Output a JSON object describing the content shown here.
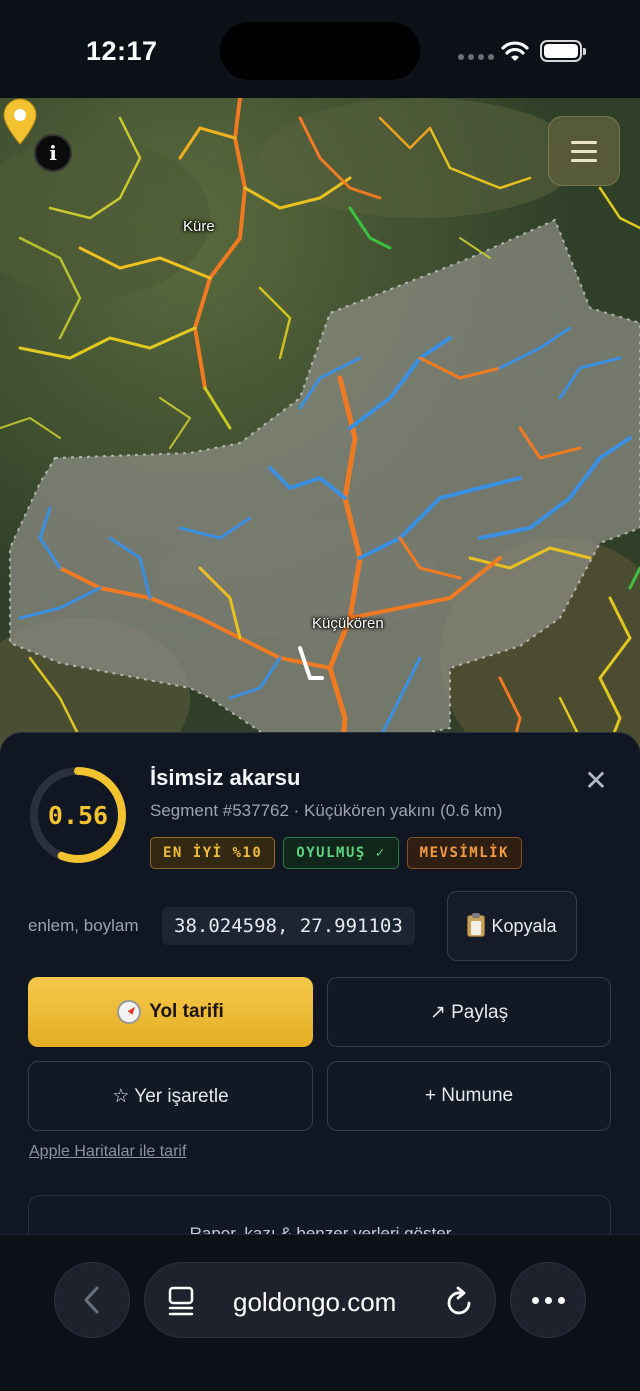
{
  "status_bar": {
    "time": "12:17"
  },
  "map": {
    "places": [
      {
        "name": "Küre"
      },
      {
        "name": "Küçükören"
      }
    ],
    "info_icon": "info-icon",
    "menu_icon": "hamburger-menu-icon",
    "pin_color": "#f2c230"
  },
  "detail": {
    "score": "0.56",
    "score_fraction": 0.56,
    "title": "İsimsiz akarsu",
    "subtitle": "Segment #537762 · Küçükören yakını (0.6 km)",
    "badges": [
      {
        "label": "EN İYİ %10",
        "tone": "gold"
      },
      {
        "label": "OYULMUŞ ✓",
        "tone": "green"
      },
      {
        "label": "MEVSİMLİK",
        "tone": "orange"
      }
    ],
    "coords_label": "enlem, boylam",
    "coords_value": "38.024598, 27.991103",
    "copy_label": "Kopyala",
    "directions_label": "Yol tarifi",
    "share_label": "↗ Paylaş",
    "bookmark_label": "☆ Yer işaretle",
    "sample_label": "+ Numune",
    "apple_maps_link": "Apple Haritalar ile tarif",
    "next_card_label": "Rapor, kazı & benzer yerleri göster"
  },
  "browser": {
    "url": "goldongo.com"
  },
  "colors": {
    "accent": "#f2c230",
    "sheet_bg": "#111722",
    "river_blue": "#3a8fe0",
    "river_orange": "#f07a22"
  }
}
